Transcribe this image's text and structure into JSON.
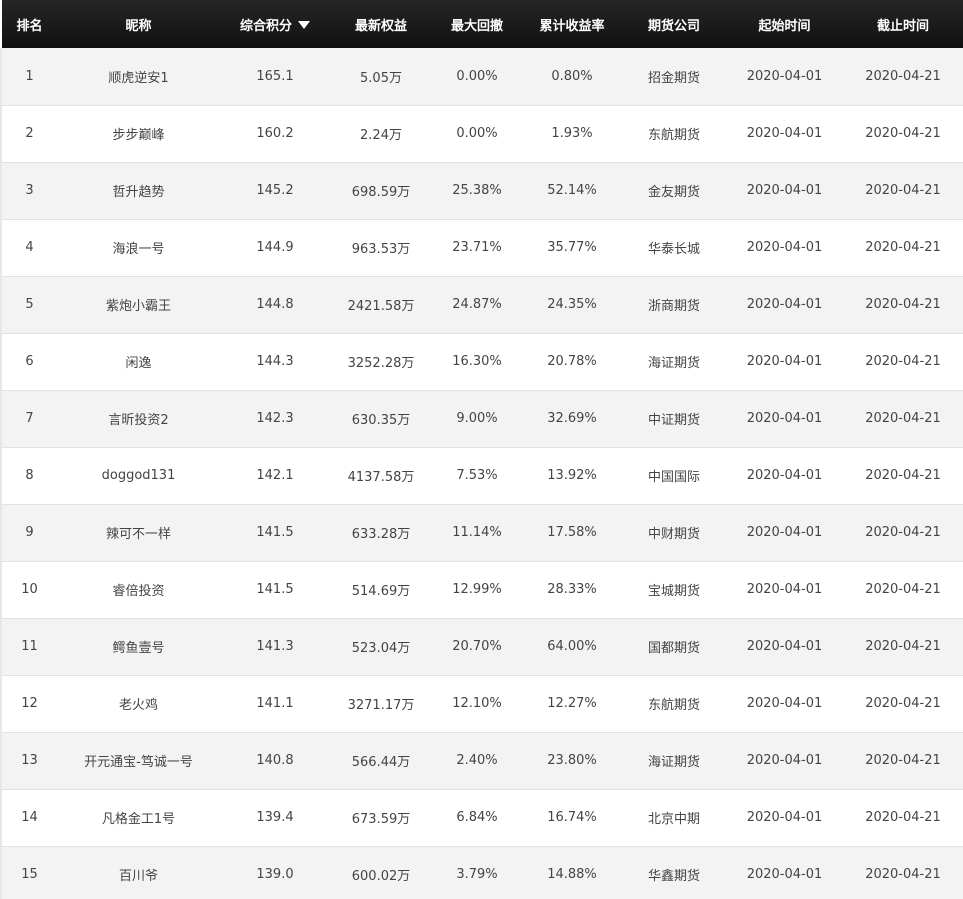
{
  "table": {
    "headers": [
      {
        "label": "排名",
        "name": "header-rank"
      },
      {
        "label": "昵称",
        "name": "header-nickname"
      },
      {
        "label": "综合积分",
        "name": "header-score",
        "sorted": "desc"
      },
      {
        "label": "最新权益",
        "name": "header-equity"
      },
      {
        "label": "最大回撤",
        "name": "header-max-drawdown"
      },
      {
        "label": "累计收益率",
        "name": "header-cumulative-return"
      },
      {
        "label": "期货公司",
        "name": "header-futures-company"
      },
      {
        "label": "起始时间",
        "name": "header-start-date"
      },
      {
        "label": "截止时间",
        "name": "header-end-date"
      }
    ],
    "rows": [
      [
        "1",
        "顺虎逆安1",
        "165.1",
        "5.05万",
        "0.00%",
        "0.80%",
        "招金期货",
        "2020-04-01",
        "2020-04-21"
      ],
      [
        "2",
        "步步巅峰",
        "160.2",
        "2.24万",
        "0.00%",
        "1.93%",
        "东航期货",
        "2020-04-01",
        "2020-04-21"
      ],
      [
        "3",
        "哲升趋势",
        "145.2",
        "698.59万",
        "25.38%",
        "52.14%",
        "金友期货",
        "2020-04-01",
        "2020-04-21"
      ],
      [
        "4",
        "海浪一号",
        "144.9",
        "963.53万",
        "23.71%",
        "35.77%",
        "华泰长城",
        "2020-04-01",
        "2020-04-21"
      ],
      [
        "5",
        "紫炮小霸王",
        "144.8",
        "2421.58万",
        "24.87%",
        "24.35%",
        "浙商期货",
        "2020-04-01",
        "2020-04-21"
      ],
      [
        "6",
        "闲逸",
        "144.3",
        "3252.28万",
        "16.30%",
        "20.78%",
        "海证期货",
        "2020-04-01",
        "2020-04-21"
      ],
      [
        "7",
        "言昕投资2",
        "142.3",
        "630.35万",
        "9.00%",
        "32.69%",
        "中证期货",
        "2020-04-01",
        "2020-04-21"
      ],
      [
        "8",
        "doggod131",
        "142.1",
        "4137.58万",
        "7.53%",
        "13.92%",
        "中国国际",
        "2020-04-01",
        "2020-04-21"
      ],
      [
        "9",
        "辣可不一样",
        "141.5",
        "633.28万",
        "11.14%",
        "17.58%",
        "中财期货",
        "2020-04-01",
        "2020-04-21"
      ],
      [
        "10",
        "睿倍投资",
        "141.5",
        "514.69万",
        "12.99%",
        "28.33%",
        "宝城期货",
        "2020-04-01",
        "2020-04-21"
      ],
      [
        "11",
        "鳄鱼壹号",
        "141.3",
        "523.04万",
        "20.70%",
        "64.00%",
        "国都期货",
        "2020-04-01",
        "2020-04-21"
      ],
      [
        "12",
        "老火鸡",
        "141.1",
        "3271.17万",
        "12.10%",
        "12.27%",
        "东航期货",
        "2020-04-01",
        "2020-04-21"
      ],
      [
        "13",
        "开元通宝-笃诚一号",
        "140.8",
        "566.44万",
        "2.40%",
        "23.80%",
        "海证期货",
        "2020-04-01",
        "2020-04-21"
      ],
      [
        "14",
        "凡格金工1号",
        "139.4",
        "673.59万",
        "6.84%",
        "16.74%",
        "北京中期",
        "2020-04-01",
        "2020-04-21"
      ],
      [
        "15",
        "百川爷",
        "139.0",
        "600.02万",
        "3.79%",
        "14.88%",
        "华鑫期货",
        "2020-04-01",
        "2020-04-21"
      ]
    ]
  },
  "icons": {
    "sort": "sort-descending-icon"
  },
  "colors": {
    "header_bg": "#1b1b1b",
    "header_text": "#ffffff",
    "row_alt": "#f3f3f3",
    "row_text": "#444444"
  }
}
